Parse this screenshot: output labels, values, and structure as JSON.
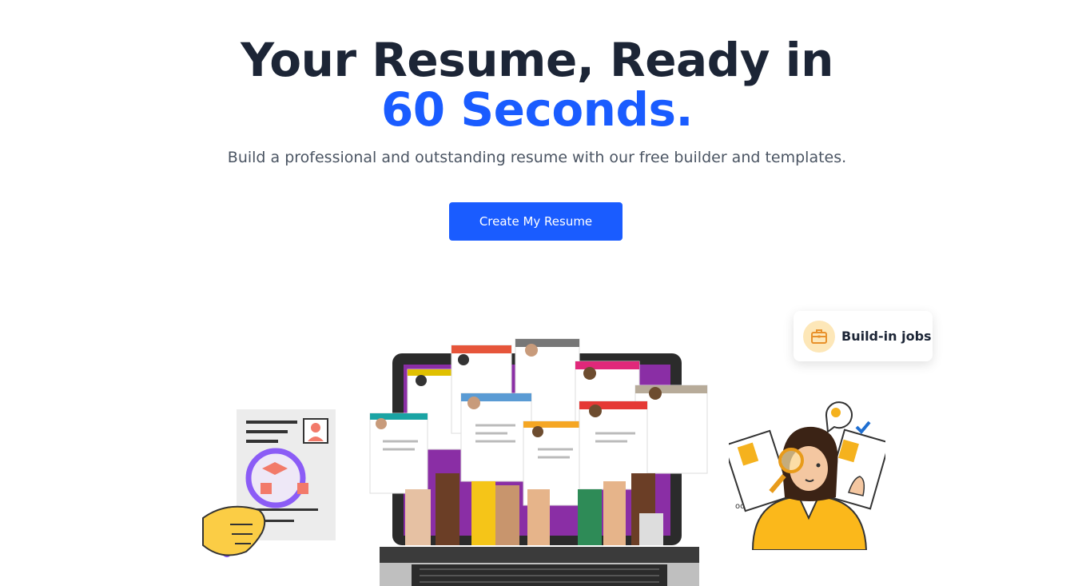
{
  "hero": {
    "title_line1": "Your Resume, Ready in",
    "title_line2": "60 Seconds.",
    "subtitle": "Build a professional and outstanding resume with our free builder and templates.",
    "cta_label": "Create My Resume"
  },
  "badge": {
    "label": "Build-in jobs",
    "icon": "briefcase-icon"
  },
  "colors": {
    "accent": "#1a5cff",
    "heading": "#1c2536",
    "badge_bg": "#fde7b8",
    "badge_icon": "#e8912b"
  }
}
